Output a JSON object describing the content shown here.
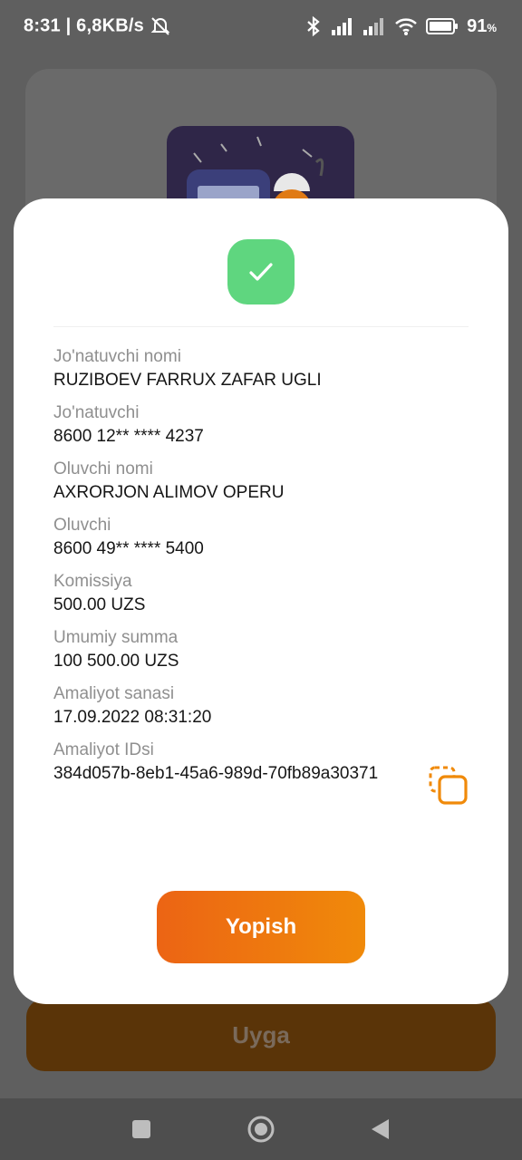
{
  "status_bar": {
    "time": "8:31",
    "separator": "|",
    "speed": "6,8KB/s",
    "battery_percent": "91",
    "battery_unit": "%"
  },
  "background": {
    "home_button_label": "Uyga"
  },
  "modal": {
    "fields": [
      {
        "label": "Jo'natuvchi nomi",
        "value": "RUZIBOEV FARRUX ZAFAR UGLI"
      },
      {
        "label": "Jo'natuvchi",
        "value": "8600 12** **** 4237"
      },
      {
        "label": "Oluvchi nomi",
        "value": "AXRORJON ALIMOV OPERU"
      },
      {
        "label": "Oluvchi",
        "value": "8600 49** **** 5400"
      },
      {
        "label": "Komissiya",
        "value": "500.00 UZS"
      },
      {
        "label": "Umumiy summa",
        "value": "100 500.00 UZS"
      },
      {
        "label": "Amaliyot sanasi",
        "value": "17.09.2022 08:31:20"
      },
      {
        "label": "Amaliyot IDsi",
        "value": "384d057b-8eb1-45a6-989d-70fb89a30371"
      }
    ],
    "close_button_label": "Yopish"
  },
  "colors": {
    "success": "#5fd67f",
    "accent_start": "#ec6414",
    "accent_end": "#f08a0a",
    "copy_icon": "#f08a0a"
  },
  "icons": {
    "status_check": "checkmark-icon",
    "copy": "copy-icon",
    "nav_recent": "square-icon",
    "nav_home": "circle-icon",
    "nav_back": "triangle-back-icon"
  }
}
